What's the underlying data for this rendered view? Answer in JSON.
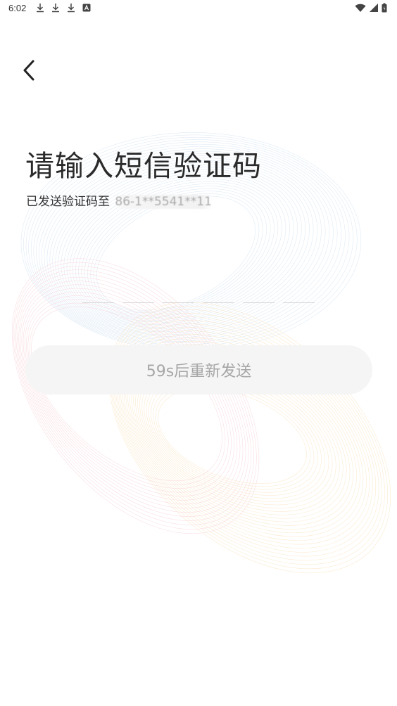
{
  "status_bar": {
    "time": "6:02",
    "left_icons": [
      "download-icon",
      "download-icon",
      "download-icon",
      "translate-icon"
    ],
    "right_icons": [
      "wifi-icon",
      "signal-icon",
      "battery-icon"
    ]
  },
  "header": {
    "back_icon": "chevron-left-icon"
  },
  "main": {
    "title": "请输入短信验证码",
    "subtitle_prefix": "已发送验证码至",
    "phone_number": "86-1**5541**11",
    "code_length": 6,
    "resend_label": "59s后重新发送"
  },
  "colors": {
    "button_bg": "#f5f5f5",
    "button_text": "#a6a6a6",
    "underline": "#d8d8d8",
    "wave_blue": "#b9d3ea",
    "wave_orange": "#f7d39a",
    "wave_pink": "#f4b7c0"
  }
}
